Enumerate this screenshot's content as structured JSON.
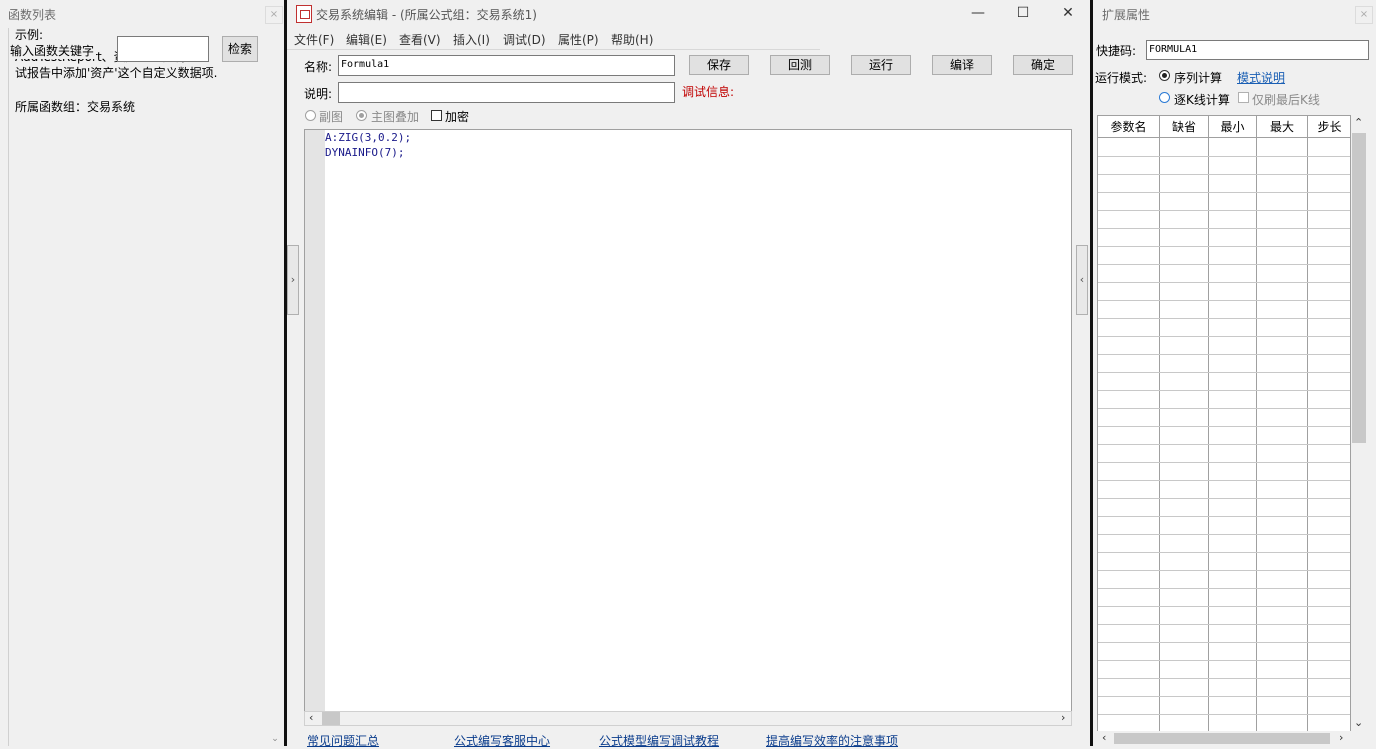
{
  "left_panel": {
    "title": "函数列表",
    "close": "×",
    "search_label": "输入函数关键字",
    "search_placeholder": "",
    "search_button": "检索",
    "description_lines": [
      "示例:",
      "AddTestReport、资产、...在调",
      "试报告中添加'资产'这个自定义数据项."
    ],
    "group_line": "所属函数组：交易系统"
  },
  "editor": {
    "window_title": "交易系统编辑 - (所属公式组：交易系统1)",
    "menu": [
      "文件(F)",
      "编辑(E)",
      "查看(V)",
      "插入(I)",
      "调试(D)",
      "属性(P)",
      "帮助(H)"
    ],
    "name_label": "名称:",
    "name_value": "Formula1",
    "desc_label": "说明:",
    "desc_value": "",
    "debug_label": "调试信息:",
    "buttons": {
      "save": "保存",
      "backtest": "回测",
      "run": "运行",
      "compile": "编译",
      "ok": "确定"
    },
    "options": {
      "sub_chart": "副图",
      "main_overlay": "主图叠加",
      "encrypt": "加密"
    },
    "code_lines": [
      "A:ZIG(3,0.2);",
      "DYNAINFO(7);"
    ],
    "links": [
      "常见问题汇总",
      "公式编写客服中心",
      "公式模型编写调试教程",
      "提高编写效率的注意事项"
    ]
  },
  "right_panel": {
    "title": "扩展属性",
    "close": "×",
    "shortcut_label": "快捷码:",
    "shortcut_value": "FORMULA1",
    "run_mode_label": "运行模式:",
    "mode_sequence": "序列计算",
    "mode_help_link": "模式说明",
    "mode_tick": "逐K线计算",
    "refresh_last_only": "仅刷最后K线",
    "table_headers": [
      "参数名",
      "缺省",
      "最小",
      "最大",
      "步长"
    ]
  },
  "colors": {
    "accent_link": "#0a3c8c",
    "debug_red": "#c00000",
    "code_blue": "#1a1a8a"
  }
}
